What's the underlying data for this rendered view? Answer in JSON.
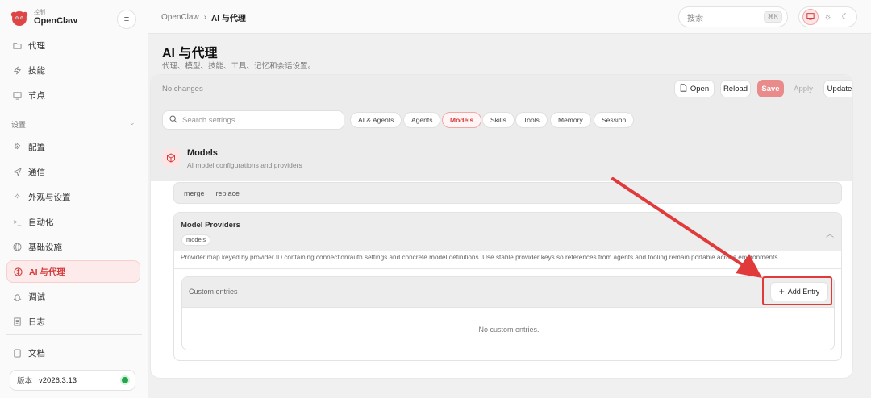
{
  "brand": {
    "sub": "控制",
    "name": "OpenClaw"
  },
  "sidebar": {
    "items_top": [
      {
        "label": "代理",
        "icon": "folder-icon"
      },
      {
        "label": "技能",
        "icon": "zap-icon"
      },
      {
        "label": "节点",
        "icon": "monitor-icon"
      }
    ],
    "section_label": "设置",
    "items_settings": [
      {
        "label": "配置",
        "icon": "gear-icon"
      },
      {
        "label": "通信",
        "icon": "send-icon"
      },
      {
        "label": "外观与设置",
        "icon": "sparkle-icon"
      },
      {
        "label": "自动化",
        "icon": "terminal-icon"
      },
      {
        "label": "基础设施",
        "icon": "globe-icon"
      },
      {
        "label": "AI 与代理",
        "icon": "brain-icon",
        "active": true
      },
      {
        "label": "调试",
        "icon": "bug-icon"
      },
      {
        "label": "日志",
        "icon": "scroll-icon"
      }
    ],
    "docs_label": "文档",
    "version_key": "版本",
    "version_value": "v2026.3.13",
    "status_color": "#20a84a"
  },
  "topbar": {
    "breadcrumb_root": "OpenClaw",
    "breadcrumb_sep": "›",
    "breadcrumb_current": "AI 与代理",
    "search_placeholder": "搜索",
    "search_shortcut": "⌘K",
    "theme_options": [
      "monitor-icon",
      "sun-icon",
      "moon-icon"
    ]
  },
  "page": {
    "title": "AI 与代理",
    "subtitle": "代理、模型、技能、工具、记忆和会话设置。"
  },
  "config": {
    "status": "No changes",
    "buttons": {
      "open": "Open",
      "reload": "Reload",
      "save": "Save",
      "apply": "Apply",
      "update": "Update"
    },
    "search_placeholder": "Search settings...",
    "chips": [
      "AI & Agents",
      "Agents",
      "Models",
      "Skills",
      "Tools",
      "Memory",
      "Session"
    ],
    "active_chip": "Models",
    "section_title": "Models",
    "section_subtitle": "AI model configurations and providers",
    "merge_options": [
      "merge",
      "replace"
    ],
    "providers": {
      "title": "Model Providers",
      "tag": "models",
      "description": "Provider map keyed by provider ID containing connection/auth settings and concrete model definitions. Use stable provider keys so references from agents and tooling remain portable across environments.",
      "custom_entries_label": "Custom entries",
      "add_entry_label": "Add Entry",
      "empty_text": "No custom entries."
    }
  },
  "colors": {
    "accent": "#d23b3b",
    "annotation": "#e03a3a"
  }
}
